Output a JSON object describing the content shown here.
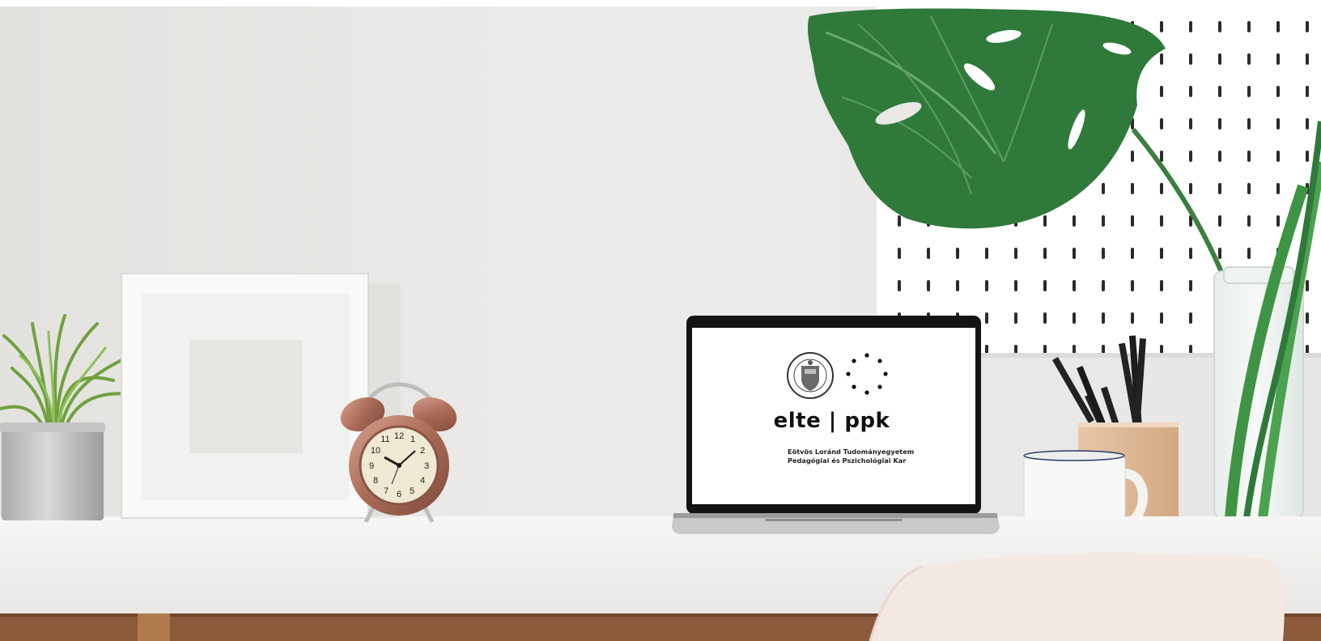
{
  "screen": {
    "brand": "elte | ppk",
    "line1": "Eötvös Loránd Tudományegyetem",
    "line2": "Pedagógiai és Pszichológiai Kar"
  },
  "seal_text": "ELTE PEDAGÓGIAI ÉS PSZICHOLÓGIAI KAR",
  "colors": {
    "wall": "#e9e8e6",
    "desk": "#f2f1ef",
    "pegboard": "#ffffff",
    "leaf": "#2f7a3a",
    "clock_copper": "#b07762",
    "chair": "#f4e8e3"
  }
}
